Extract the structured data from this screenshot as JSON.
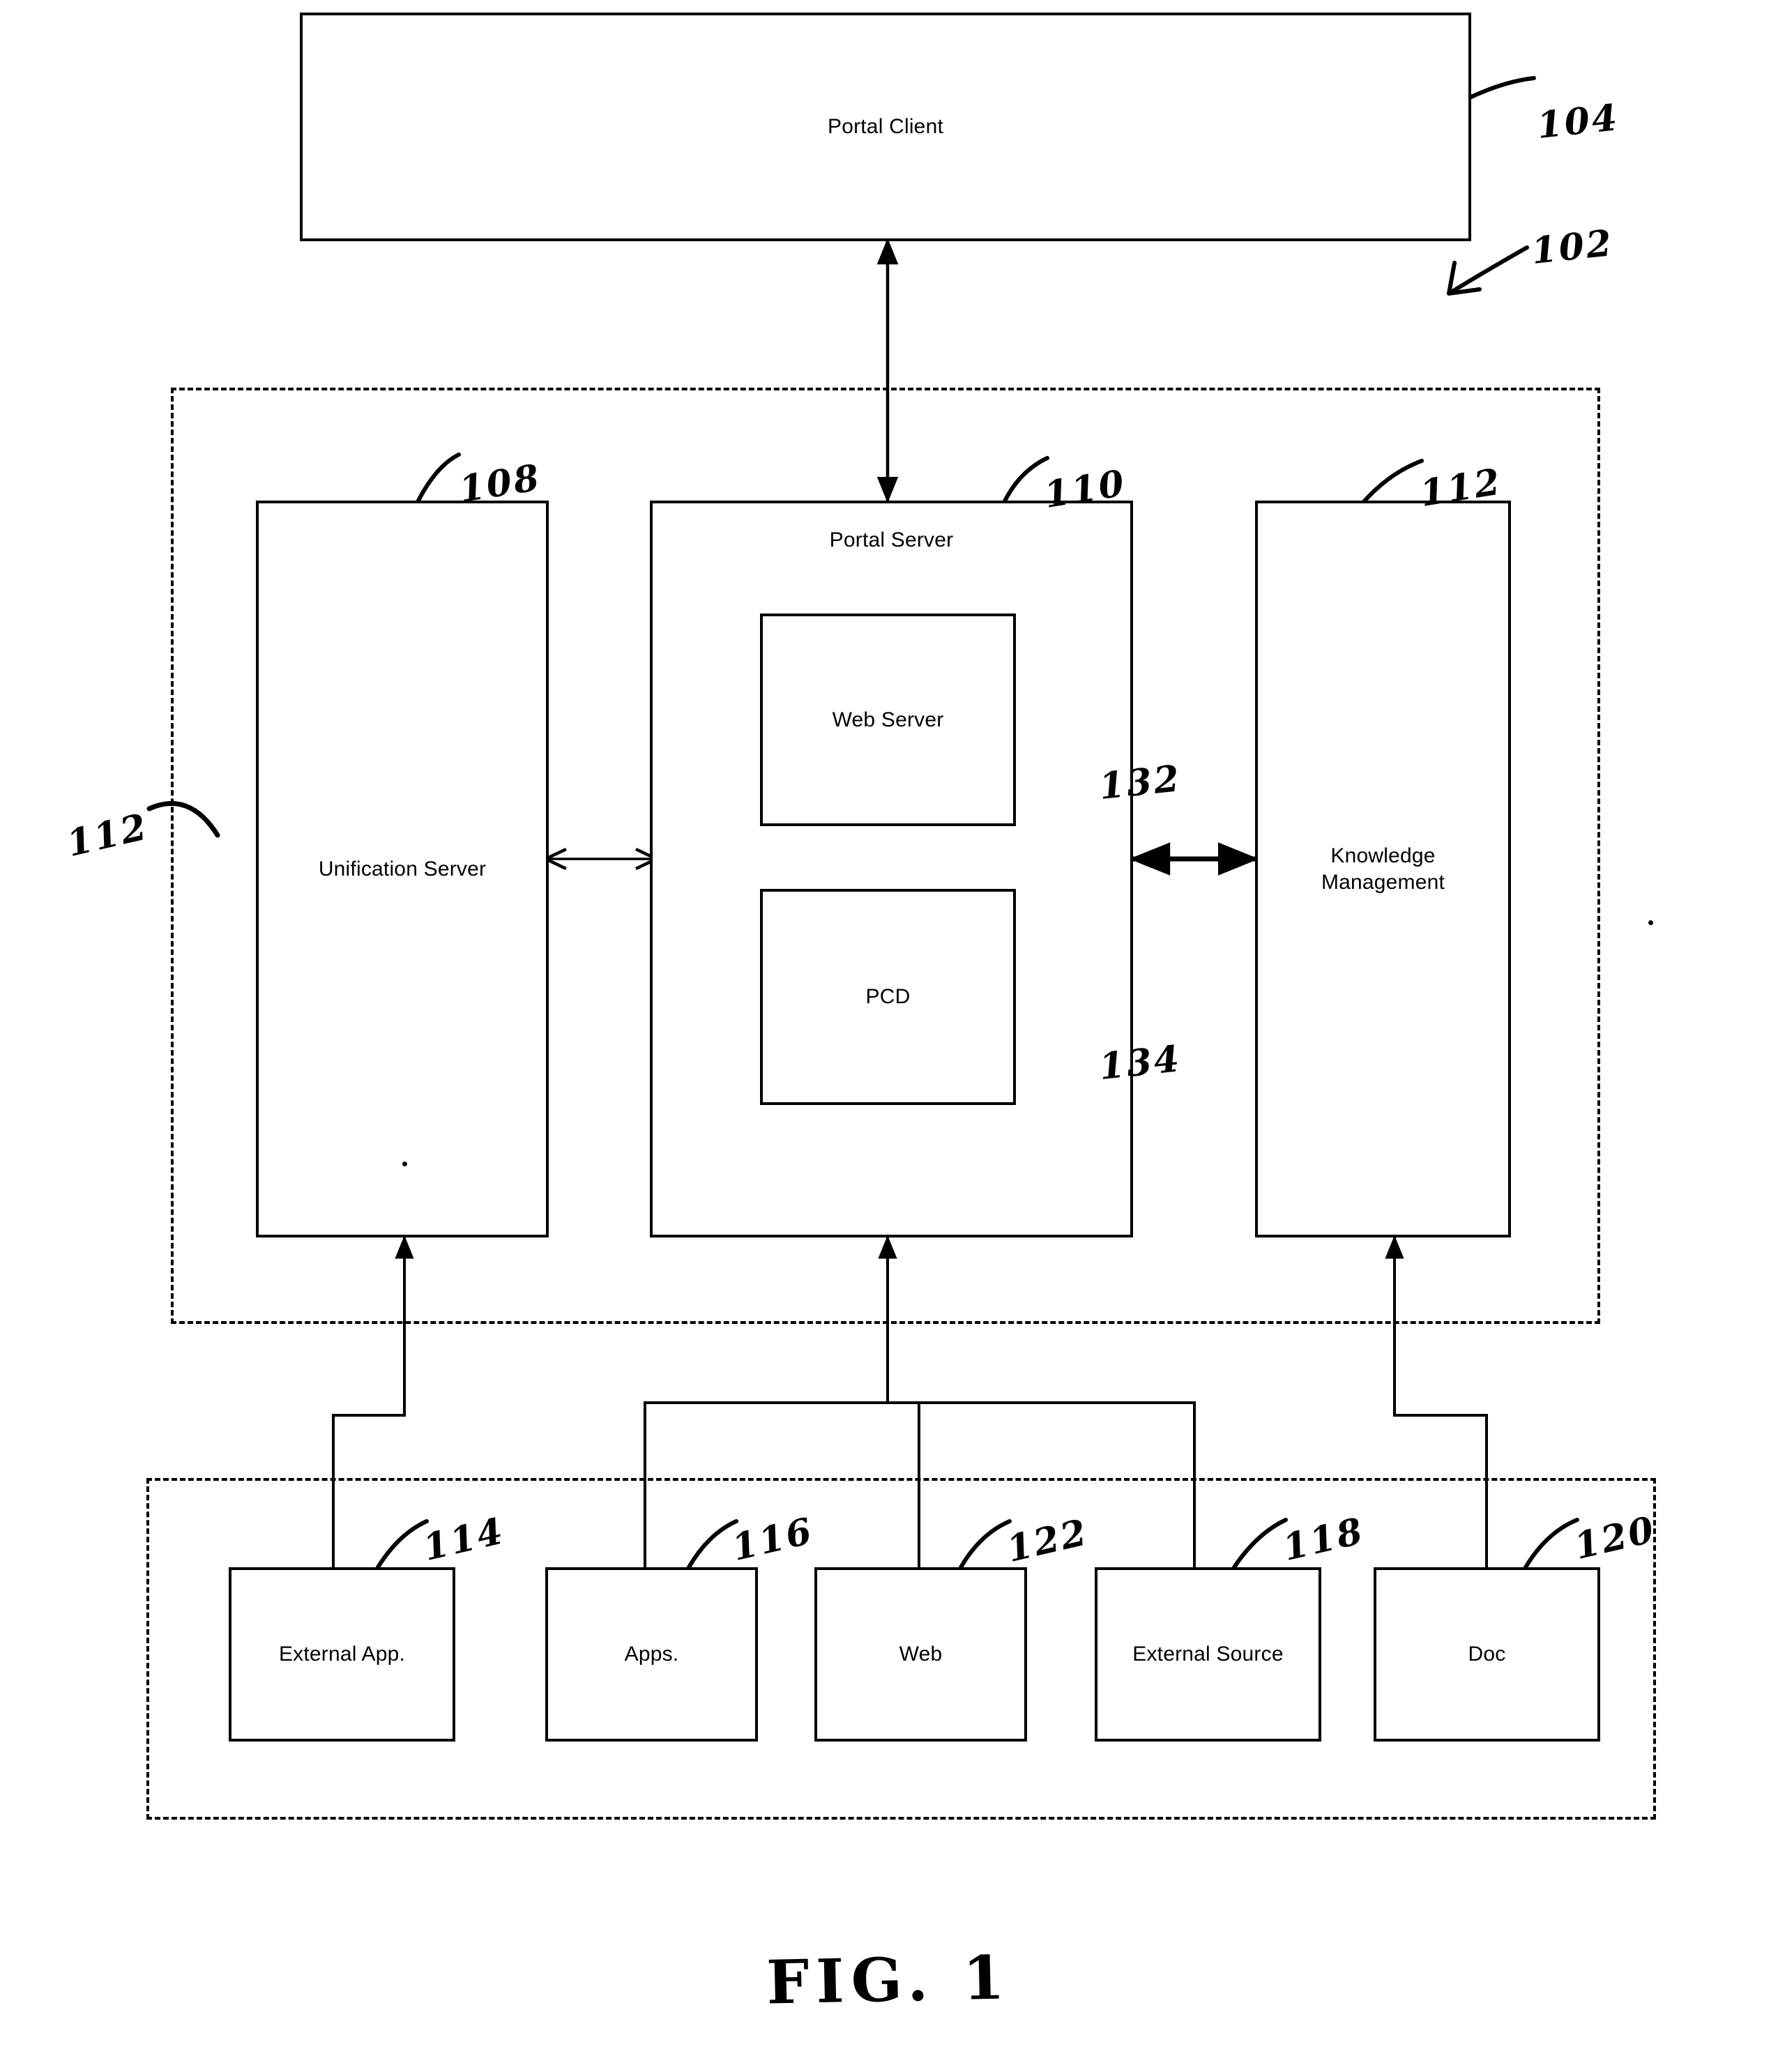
{
  "figure": {
    "caption": "FIG. 1",
    "system_ref": "102"
  },
  "client": {
    "label": "Portal Client",
    "ref": "104"
  },
  "portal_region": {
    "ref": "112"
  },
  "servers": [
    {
      "id": "unification-server",
      "label": "Unification Server",
      "ref": "108"
    },
    {
      "id": "portal-server",
      "label": "Portal Server",
      "ref": "110"
    },
    {
      "id": "knowledge-management",
      "label": "Knowledge\nManagement",
      "ref": "112"
    }
  ],
  "portal_server_children": [
    {
      "id": "web-server",
      "label": "Web Server",
      "ref": "132"
    },
    {
      "id": "pcd",
      "label": "PCD",
      "ref": "134"
    }
  ],
  "sources": [
    {
      "id": "external-app",
      "label": "External App.",
      "ref": "114"
    },
    {
      "id": "apps",
      "label": "Apps.",
      "ref": "116"
    },
    {
      "id": "web",
      "label": "Web",
      "ref": "122"
    },
    {
      "id": "external-source",
      "label": "External Source",
      "ref": "118"
    },
    {
      "id": "doc",
      "label": "Doc",
      "ref": "120"
    }
  ],
  "colors": {
    "line": "#000000",
    "background": "#ffffff"
  }
}
